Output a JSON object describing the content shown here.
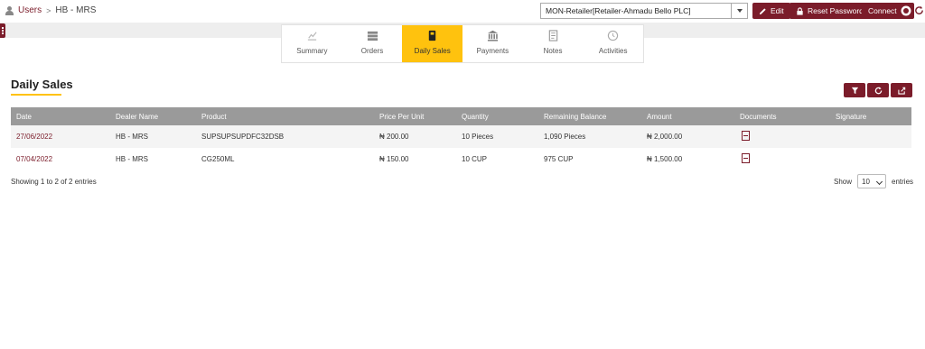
{
  "breadcrumb": {
    "root": "Users",
    "current": "HB - MRS"
  },
  "header": {
    "account_select": "MON-Retailer[Retailer-Ahmadu Bello PLC]",
    "edit_label": "Edit",
    "reset_password_label": "Reset Password",
    "connect_label": "Connect"
  },
  "tabs": [
    {
      "label": "Summary",
      "icon": "chart-icon"
    },
    {
      "label": "Orders",
      "icon": "orders-icon"
    },
    {
      "label": "Daily Sales",
      "icon": "fuel-icon",
      "active": true
    },
    {
      "label": "Payments",
      "icon": "bank-icon"
    },
    {
      "label": "Notes",
      "icon": "notes-icon"
    },
    {
      "label": "Activities",
      "icon": "clock-icon"
    }
  ],
  "page": {
    "title": "Daily Sales"
  },
  "table": {
    "columns": [
      "Date",
      "Dealer Name",
      "Product",
      "Price Per Unit",
      "Quantity",
      "Remaining Balance",
      "Amount",
      "Documents",
      "Signature"
    ],
    "rows": [
      {
        "date": "27/06/2022",
        "dealer": "HB - MRS",
        "product": "SUPSUPSUPDFC32DSB",
        "price": "₦ 200.00",
        "quantity": "10 Pieces",
        "balance": "1,090 Pieces",
        "amount": "₦ 2,000.00",
        "signature": ""
      },
      {
        "date": "07/04/2022",
        "dealer": "HB - MRS",
        "product": "CG250ML",
        "price": "₦ 150.00",
        "quantity": "10 CUP",
        "balance": "975 CUP",
        "amount": "₦ 1,500.00",
        "signature": ""
      }
    ]
  },
  "footer": {
    "info": "Showing 1 to 2 of 2 entries",
    "show_label": "Show",
    "page_size": "10",
    "entries_label": "entries"
  },
  "colors": {
    "brand": "#7b1c2a",
    "accent": "#ffc20e",
    "header_row": "#9a9a9a"
  }
}
